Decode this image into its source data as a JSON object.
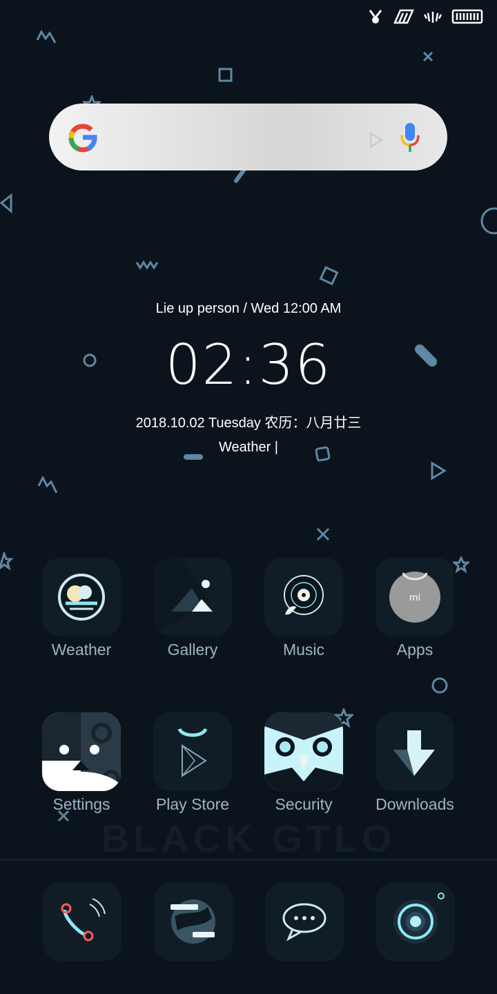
{
  "status_bar": {
    "icons": [
      "bunny-icon",
      "signal-icon",
      "wifi-icon",
      "battery-icon"
    ]
  },
  "search_bar": {
    "icons": [
      "google-logo-icon",
      "play-icon",
      "microphone-icon"
    ]
  },
  "widget": {
    "top_line": "Lie up person   /  Wed 12:00 AM",
    "time": "02:36",
    "date_line": "2018.10.02  Tuesday  农历：八月廿三",
    "weather_line": "Weather |"
  },
  "apps_row1": [
    {
      "label": "Weather",
      "icon": "weather-icon"
    },
    {
      "label": "Gallery",
      "icon": "gallery-icon"
    },
    {
      "label": "Music",
      "icon": "music-icon"
    },
    {
      "label": "Apps",
      "icon": "apps-icon"
    }
  ],
  "apps_row2": [
    {
      "label": "Settings",
      "icon": "settings-icon"
    },
    {
      "label": "Play Store",
      "icon": "play-store-icon"
    },
    {
      "label": "Security",
      "icon": "security-icon"
    },
    {
      "label": "Downloads",
      "icon": "downloads-icon"
    }
  ],
  "watermark": "BLACK GTLO",
  "dock": [
    {
      "icon": "phone-icon"
    },
    {
      "icon": "browser-icon"
    },
    {
      "icon": "messages-icon"
    },
    {
      "icon": "camera-icon"
    }
  ],
  "colors": {
    "background": "#0b141c",
    "decor": "#5f88a5",
    "label": "#9fb4c3",
    "accent": "#8fe7f4"
  }
}
